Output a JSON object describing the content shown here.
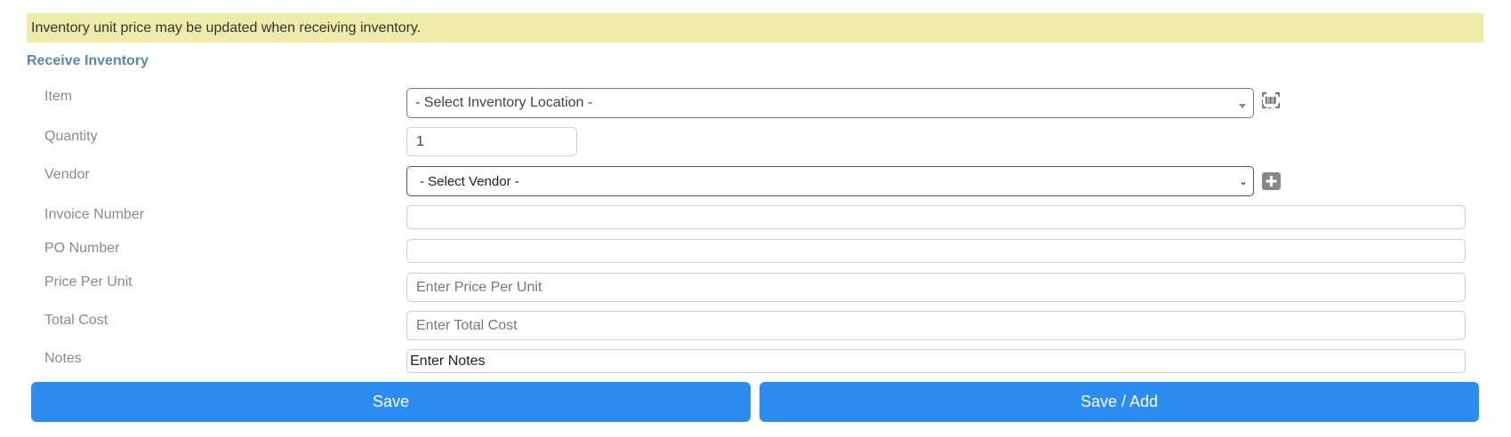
{
  "banner": {
    "text": "Inventory unit price may be updated when receiving inventory."
  },
  "form": {
    "title": "Receive Inventory",
    "labels": {
      "item": "Item",
      "quantity": "Quantity",
      "vendor": "Vendor",
      "invoice_number": "Invoice Number",
      "po_number": "PO Number",
      "price_per_unit": "Price Per Unit",
      "total_cost": "Total Cost",
      "notes": "Notes"
    },
    "item_select": {
      "selected": "- Select Inventory Location -"
    },
    "quantity_value": "1",
    "vendor_select": {
      "selected": "- Select Vendor -"
    },
    "invoice_number_value": "",
    "po_number_value": "",
    "price_per_unit_placeholder": "Enter Price Per Unit",
    "total_cost_placeholder": "Enter Total Cost",
    "notes_value": "Enter Notes"
  },
  "buttons": {
    "save": "Save",
    "save_add": "Save / Add"
  },
  "icons": {
    "barcode": "barcode-scan-icon",
    "add_vendor": "plus-square-icon"
  },
  "colors": {
    "banner_bg": "#efeba8",
    "title": "#5b86b5",
    "button_bg": "#2d8cf0"
  }
}
